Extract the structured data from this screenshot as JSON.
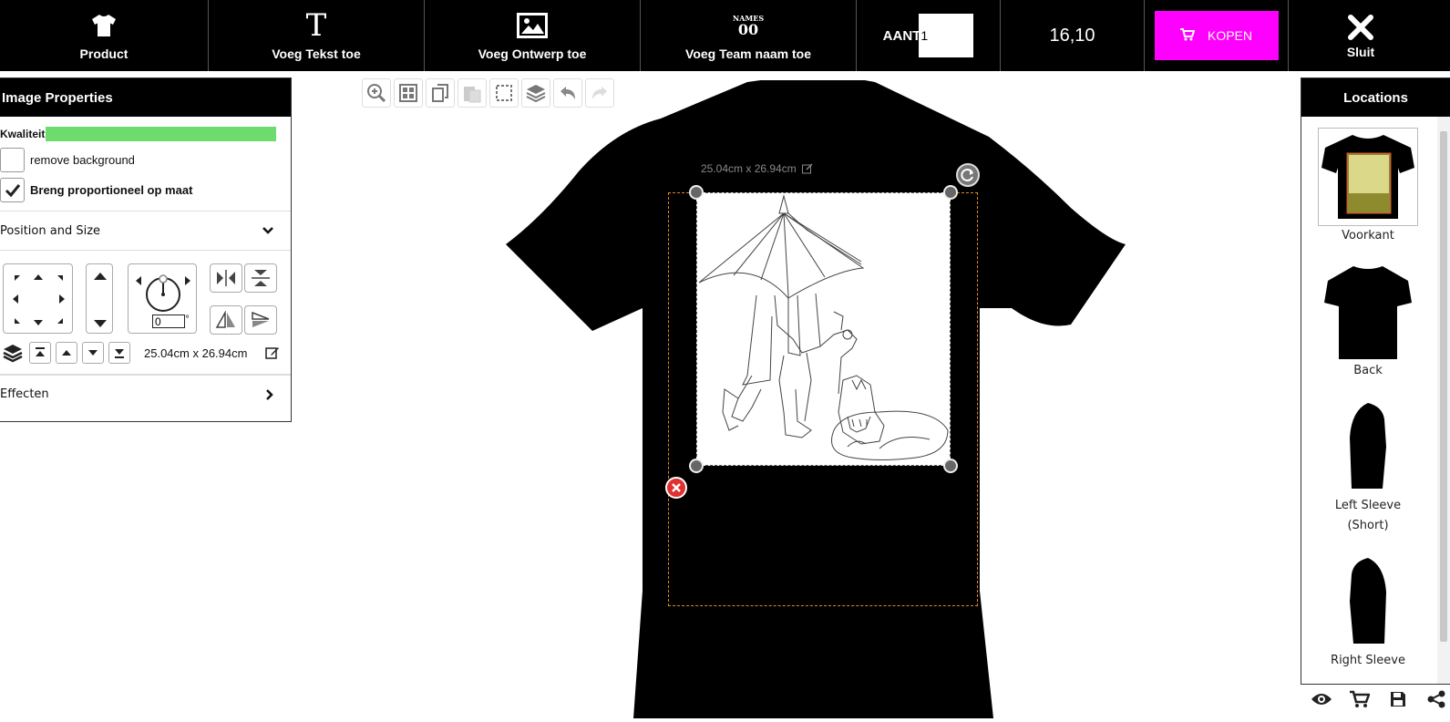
{
  "toolbar": {
    "product_label": "Product",
    "text_label": "Voeg Tekst toe",
    "design_label": "Voeg Ontwerp toe",
    "team_label": "Voeg Team naam toe",
    "team_icon_top": "NAMES",
    "team_icon_bottom": "00",
    "quantity_label": "AANT",
    "quantity_value": "1",
    "price": "16,10",
    "buy_label": "KOPEN",
    "close_label": "Sluit"
  },
  "image_properties": {
    "title": "Image Properties",
    "quality_label": "Kwaliteit",
    "quality_level": 1.0,
    "quality_color": "#6ddc6d",
    "remove_bg_label": "remove background",
    "remove_bg_checked": false,
    "proportional_label": "Breng proportioneel op maat",
    "proportional_checked": true,
    "position_size_label": "Position and Size",
    "rotation_value": "0",
    "rotation_unit": "°",
    "size_text": "25.04cm x 26.94cm",
    "effects_label": "Effecten"
  },
  "canvas": {
    "dimension_label": "25.04cm x 26.94cm",
    "tools": [
      "zoom-icon",
      "grid-icon",
      "copy-icon",
      "paste-icon",
      "select-icon",
      "layers-icon",
      "undo-icon",
      "redo-icon"
    ],
    "print_area_color": "#e58a1c"
  },
  "locations": {
    "title": "Locations",
    "items": [
      {
        "label": "Voorkant",
        "active": true
      },
      {
        "label": "Back",
        "active": false
      },
      {
        "label": "Left Sleeve (Short)",
        "active": false
      },
      {
        "label": "Right Sleeve",
        "active": false
      }
    ]
  },
  "bottom_icons": [
    "eye-icon",
    "cart-icon",
    "save-icon",
    "share-icon"
  ],
  "colors": {
    "accent": "#ff00ff",
    "toolbar_bg": "#000000",
    "shirt": "#000000"
  }
}
